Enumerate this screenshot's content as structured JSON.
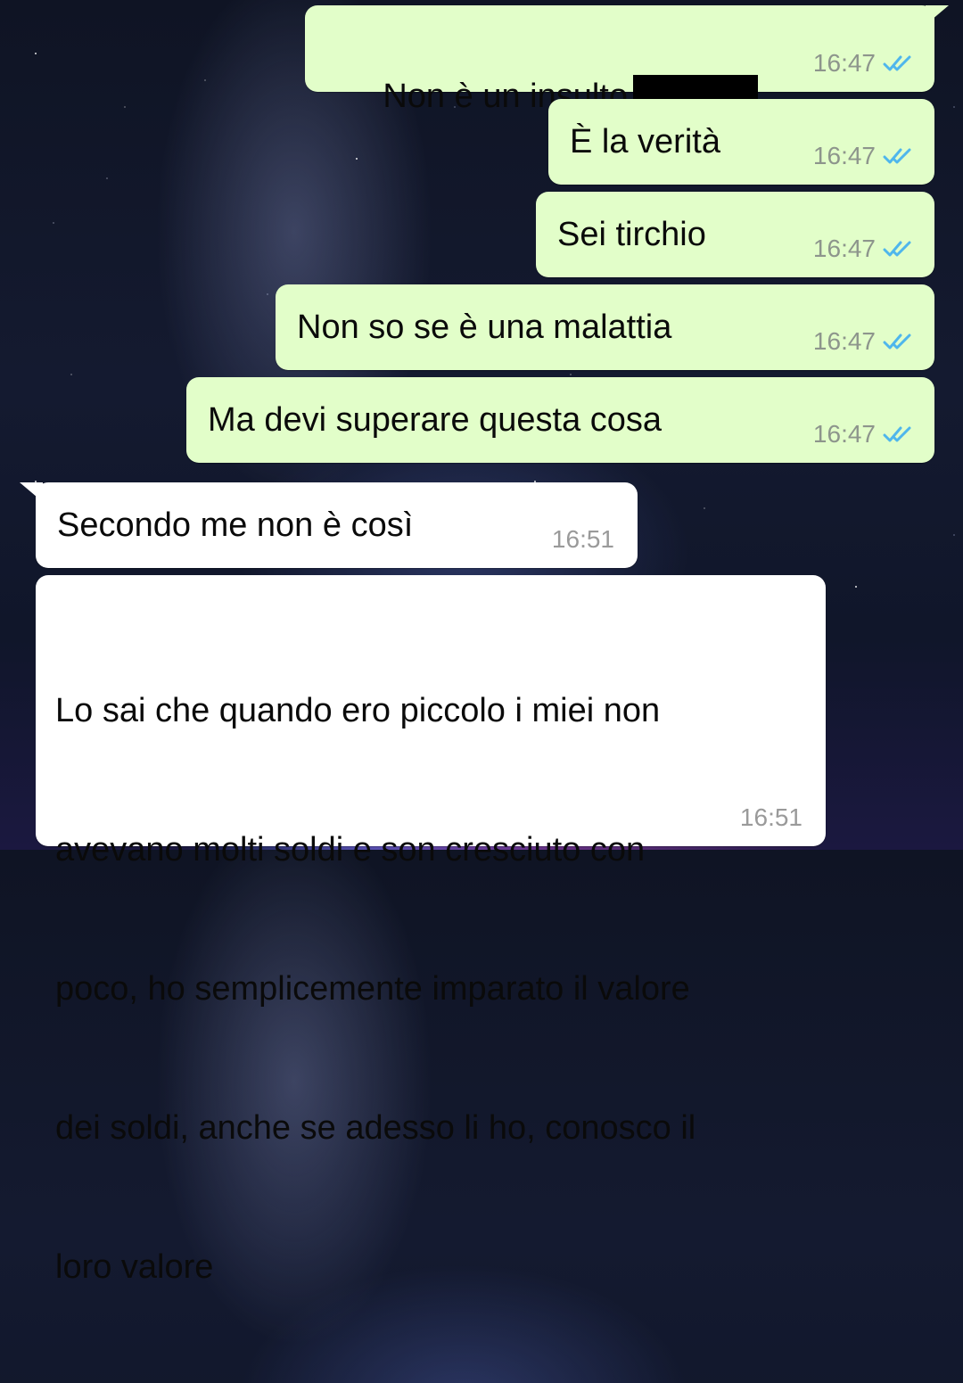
{
  "messages": [
    {
      "text": "Non è un insulto",
      "time": "16:47",
      "direction": "outgoing",
      "status": "read-double-check",
      "redacted": true
    },
    {
      "text": "È la verità",
      "time": "16:47",
      "direction": "outgoing",
      "status": "read-double-check"
    },
    {
      "text": "Sei tirchio",
      "time": "16:47",
      "direction": "outgoing",
      "status": "read-double-check"
    },
    {
      "text": "Non so se è una malattia",
      "time": "16:47",
      "direction": "outgoing",
      "status": "read-double-check"
    },
    {
      "text": "Ma devi superare questa cosa",
      "time": "16:47",
      "direction": "outgoing",
      "status": "read-double-check"
    },
    {
      "text": "Secondo me non è così",
      "time": "16:51",
      "direction": "incoming"
    },
    {
      "lines": [
        "Lo sai che quando ero piccolo i miei non",
        "avevano molti soldi e son cresciuto con",
        "poco, ho semplicemente imparato il valore",
        "dei soldi, anche se adesso li ho, conosco il",
        "loro valore"
      ],
      "time": "16:51",
      "direction": "incoming"
    }
  ],
  "colors": {
    "outgoing_bubble": "#e2fec9",
    "incoming_bubble": "#ffffff",
    "read_ticks": "#4fb6ec",
    "timestamp": "#8d958c"
  },
  "icons": {
    "read_receipt": "double-check-icon"
  }
}
